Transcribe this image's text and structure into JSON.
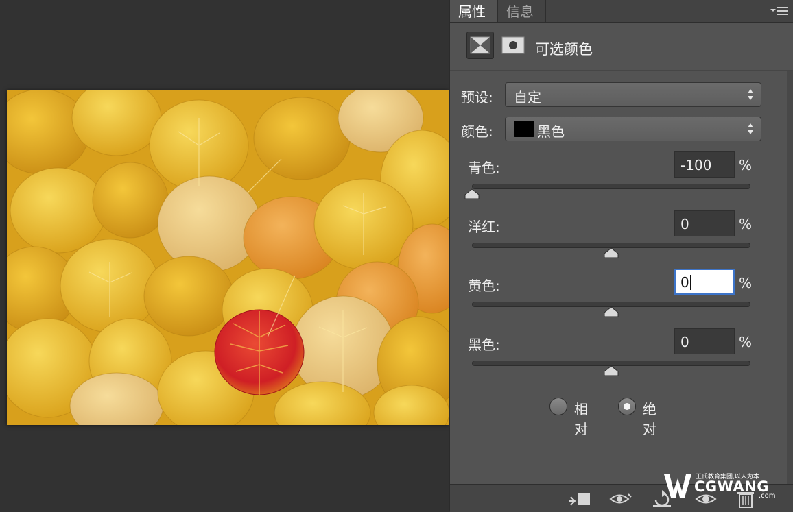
{
  "tabs": [
    {
      "label": "属性",
      "active": true
    },
    {
      "label": "信息",
      "active": false
    }
  ],
  "panel_title": "可选颜色",
  "preset": {
    "label": "预设:",
    "value": "自定"
  },
  "colors": {
    "label": "颜色:",
    "value": "黑色",
    "swatch": "#000000"
  },
  "sliders": [
    {
      "label": "青色:",
      "value": "-100",
      "unit": "%",
      "level": 0.0
    },
    {
      "label": "洋红:",
      "value": "0",
      "unit": "%",
      "level": 0.5
    },
    {
      "label": "黄色:",
      "value": "0",
      "unit": "%",
      "level": 0.5,
      "focused": true
    },
    {
      "label": "黑色:",
      "value": "0",
      "unit": "%",
      "level": 0.5
    }
  ],
  "method": {
    "options": [
      {
        "label": "相对",
        "checked": false
      },
      {
        "label": "绝对",
        "checked": true
      }
    ]
  },
  "icons": {
    "panel_menu": "panel-menu-icon",
    "adjustment": "selective-color-adjustment-icon",
    "mask": "layer-mask-icon",
    "bottom": [
      "clip-to-layer-icon",
      "view-previous-state-icon",
      "reset-icon",
      "toggle-visibility-icon",
      "delete-icon"
    ]
  },
  "watermark": {
    "tagline": "王氏教育集团,以人为本",
    "brand": "CGWANG",
    "suffix": ".com"
  },
  "theme": {
    "panel_bg": "#535353",
    "app_bg": "#323232",
    "focus_border": "#3d74c9",
    "leaf_yellow": "#e8b320",
    "leaf_red": "#d42a23"
  }
}
